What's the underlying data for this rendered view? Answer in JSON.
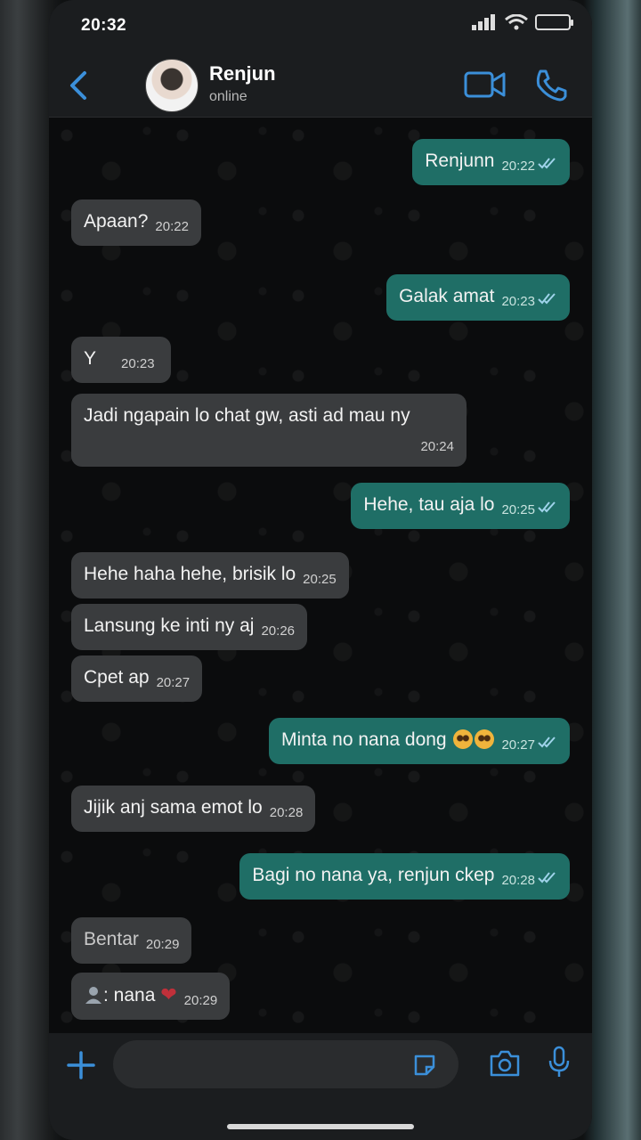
{
  "status_bar": {
    "time": "20:32"
  },
  "header": {
    "name": "Renjun",
    "status": "online"
  },
  "messages": [
    {
      "dir": "out",
      "text": "Renjunn",
      "time": "20:22"
    },
    {
      "dir": "in",
      "text": "Apaan?",
      "time": "20:22"
    },
    {
      "dir": "out",
      "text": "Galak amat",
      "time": "20:23"
    },
    {
      "dir": "in",
      "text": "Y",
      "time": "20:23"
    },
    {
      "dir": "in",
      "text": "Jadi ngapain lo chat gw, asti ad mau ny",
      "time": "20:24"
    },
    {
      "dir": "out",
      "text": "Hehe, tau aja lo",
      "time": "20:25"
    },
    {
      "dir": "in",
      "text": "Hehe haha hehe, brisik lo",
      "time": "20:25"
    },
    {
      "dir": "in",
      "text": "Lansung ke inti ny aj",
      "time": "20:26"
    },
    {
      "dir": "in",
      "text": "Cpet ap",
      "time": "20:27"
    },
    {
      "dir": "out",
      "text": "Minta no nana dong",
      "time": "20:27",
      "emoji": "pleading-face x2"
    },
    {
      "dir": "in",
      "text": "Jijik anj sama emot lo",
      "time": "20:28"
    },
    {
      "dir": "out",
      "text": "Bagi no nana ya, renjun ckep",
      "time": "20:28"
    },
    {
      "dir": "in",
      "text": "Bentar",
      "time": "20:29"
    },
    {
      "dir": "in",
      "text": ": nana",
      "time": "20:29",
      "icon": "contact-icon",
      "emoji": "heart"
    }
  ],
  "input": {
    "placeholder": ""
  },
  "colors": {
    "incoming": "#3a3c3e",
    "outgoing": "#1f6e66",
    "accent": "#3b8fd9"
  }
}
